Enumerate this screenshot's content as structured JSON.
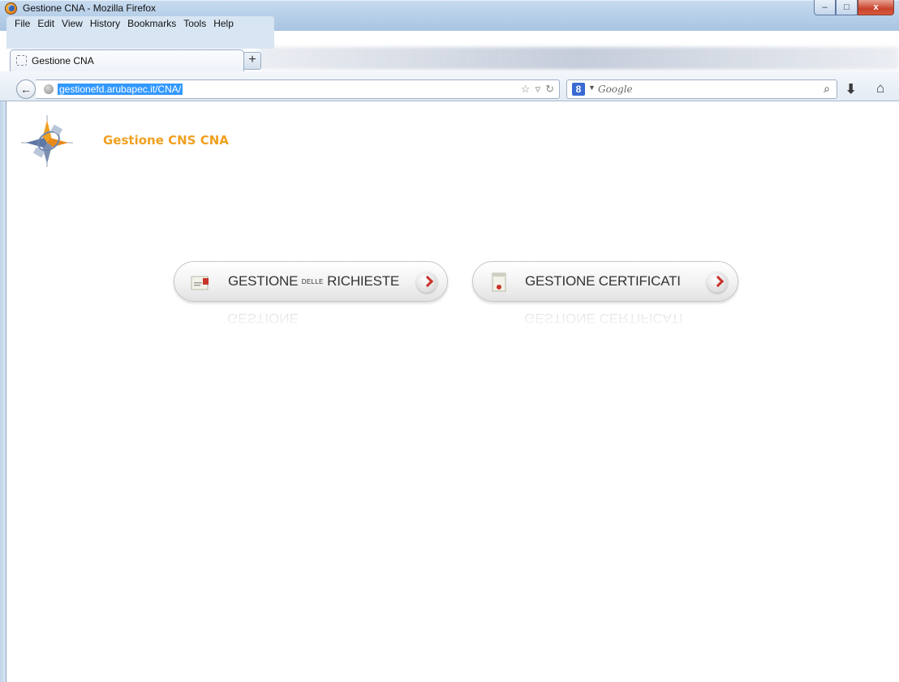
{
  "window": {
    "title": "Gestione CNA - Mozilla Firefox",
    "controls": {
      "minimize": "–",
      "maximize": "□",
      "close": "x"
    }
  },
  "menubar": {
    "items": [
      "File",
      "Edit",
      "View",
      "History",
      "Bookmarks",
      "Tools",
      "Help"
    ]
  },
  "tabs": [
    {
      "label": "Gestione CNA",
      "active": true
    }
  ],
  "newtab_label": "+",
  "navbar": {
    "url": "gestionefd.arubapec.it/CNA/",
    "search_engine": "8",
    "search_placeholder": "Google"
  },
  "page": {
    "title": "Gestione CNS CNA",
    "buttons": [
      {
        "label_part1": "GESTIONE ",
        "label_small": "DELLE",
        "label_part2": " RICHIESTE",
        "icon": "document-icon"
      },
      {
        "label_part1": "GESTIONE CERTIFICATI",
        "label_small": "",
        "label_part2": "",
        "icon": "certificate-icon"
      }
    ]
  },
  "colors": {
    "title_orange": "#f0a020",
    "arrow_red": "#c8332a",
    "selection_blue": "#3399ff"
  }
}
